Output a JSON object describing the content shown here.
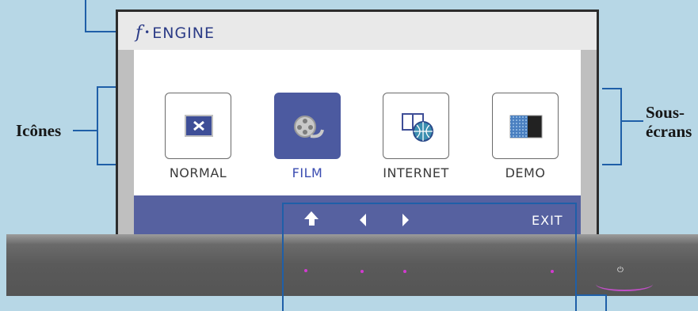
{
  "osd": {
    "title_prefix": "f",
    "title_sep": "•",
    "title_name": "ENGINE",
    "modes": [
      {
        "label": "NORMAL",
        "icon": "monitor-x-icon",
        "selected": false
      },
      {
        "label": "FILM",
        "icon": "film-reel-icon",
        "selected": true
      },
      {
        "label": "INTERNET",
        "icon": "globe-windows-icon",
        "selected": false
      },
      {
        "label": "DEMO",
        "icon": "split-screen-icon",
        "selected": false
      }
    ],
    "nav": {
      "up_icon": "up-arrow-icon",
      "left_icon": "left-arrow-icon",
      "right_icon": "right-arrow-icon",
      "exit_label": "EXIT"
    }
  },
  "callouts": {
    "icons_label": "Icônes",
    "subscreens_label_1": "Sous-",
    "subscreens_label_2": "écrans"
  },
  "colors": {
    "selected_tile": "#4c5aa0",
    "nav_bar": "#5661a0",
    "title_text": "#2b3b86",
    "callout_line": "#1f5fa8",
    "led": "#d23ad0"
  }
}
